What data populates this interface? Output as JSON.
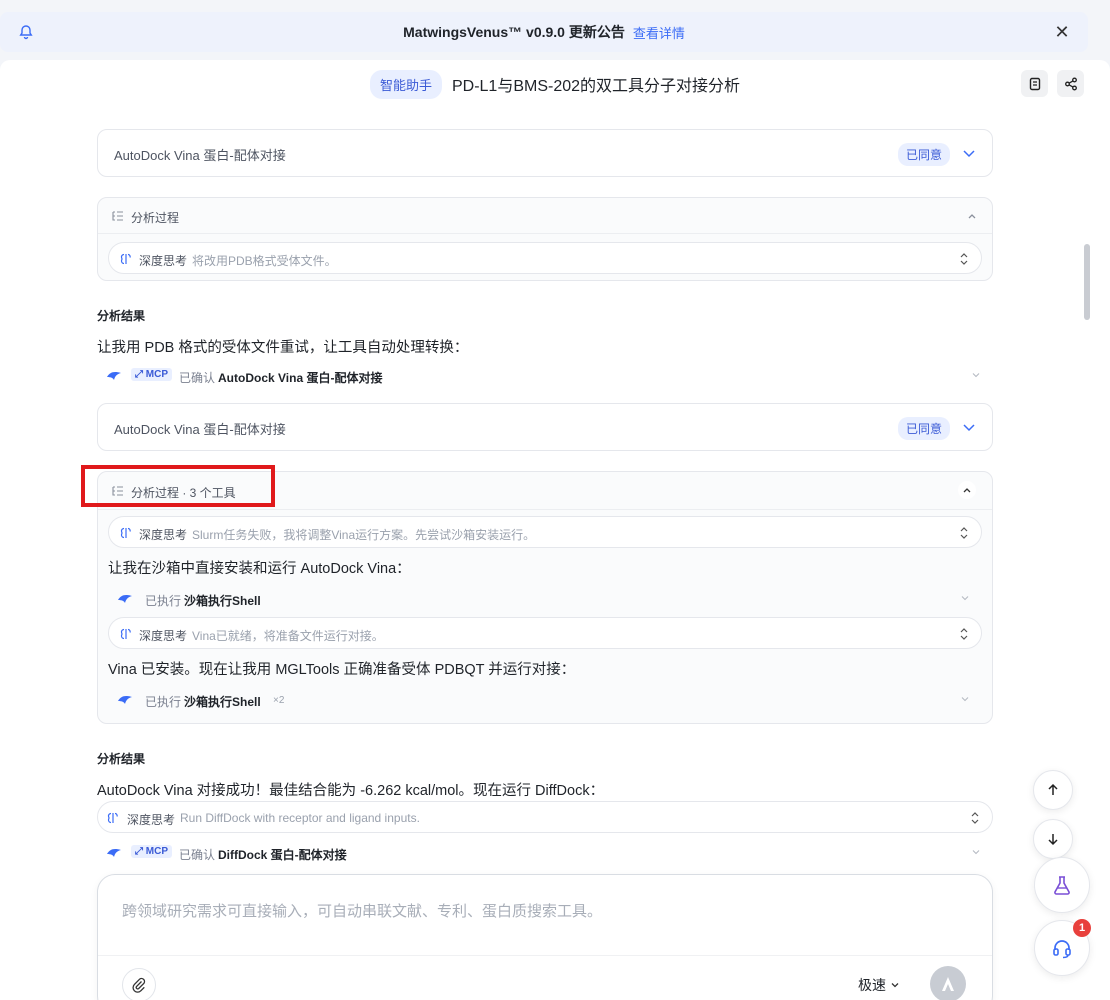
{
  "announcement": {
    "title": "MatwingsVenus™ v0.9.0 更新公告",
    "link": "查看详情"
  },
  "header": {
    "badge": "智能助手",
    "title": "PD-L1与BMS-202的双工具分子对接分析"
  },
  "tool_cards": [
    {
      "name": "AutoDock Vina 蛋白-配体对接",
      "status": "已同意"
    },
    {
      "name": "AutoDock Vina 蛋白-配体对接",
      "status": "已同意"
    }
  ],
  "process1": {
    "label": "分析过程",
    "think": {
      "key": "深度思考",
      "text": "将改用PDB格式受体文件。"
    }
  },
  "result1": {
    "heading": "分析结果",
    "text": "让我用 PDB 格式的受体文件重试，让工具自动处理转换：",
    "mcp": {
      "tag": "MCP",
      "status": "已确认",
      "tool": "AutoDock Vina 蛋白-配体对接"
    }
  },
  "process2": {
    "label": "分析过程 · 3 个工具",
    "think1": {
      "key": "深度思考",
      "text": "Slurm任务失败，我将调整Vina运行方案。先尝试沙箱安装运行。"
    },
    "text1": "让我在沙箱中直接安装和运行 AutoDock Vina：",
    "exec1": {
      "status": "已执行",
      "tool": "沙箱执行Shell"
    },
    "think2": {
      "key": "深度思考",
      "text": "Vina已就绪，将准备文件运行对接。"
    },
    "text2": "Vina 已安装。现在让我用 MGLTools 正确准备受体 PDBQT 并运行对接：",
    "exec2": {
      "status": "已执行",
      "tool": "沙箱执行Shell",
      "count": "×2"
    }
  },
  "result2": {
    "heading": "分析结果",
    "text": "AutoDock Vina 对接成功！最佳结合能为 -6.262 kcal/mol。现在运行 DiffDock：",
    "think": {
      "key": "深度思考",
      "text": "Run DiffDock with receptor and ligand inputs."
    },
    "mcp": {
      "tag": "MCP",
      "status": "已确认",
      "tool": "DiffDock 蛋白-配体对接"
    }
  },
  "input": {
    "placeholder": "跨领域研究需求可直接输入，可自动串联文献、专利、蛋白质搜索工具。",
    "speed": "极速"
  },
  "notifications": {
    "count": "1"
  },
  "colors": {
    "accent": "#3b5bd6",
    "highlight": "#e0191b",
    "notif": "#e8403c"
  }
}
